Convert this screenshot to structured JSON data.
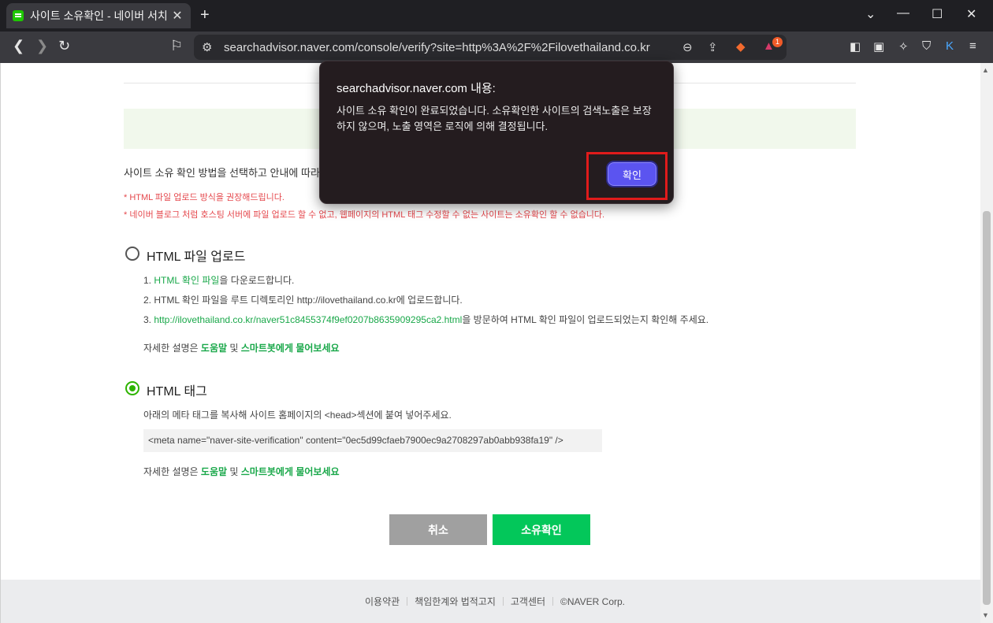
{
  "browser": {
    "tab_title": "사이트 소유확인 - 네이버 서치",
    "url": "searchadvisor.naver.com/console/verify?site=http%3A%2F%2Filovethailand.co.kr",
    "notification_count": "1"
  },
  "page": {
    "intro": "사이트 소유 확인 방법을 선택하고 안내에 따라 적용",
    "warnings": [
      "* HTML 파일 업로드 방식을 권장해드립니다.",
      "* 네이버 블로그 처럼 호스팅 서버에 파일 업로드 할 수 없고, 웹페이지의 HTML 태그 수정할 수 없는 사이트는 소유확인 할 수 없습니다."
    ],
    "html_file": {
      "title": "HTML 파일 업로드",
      "step1_prefix": "1. ",
      "step1_link": "HTML 확인 파일",
      "step1_suffix": "을 다운로드합니다.",
      "step2": "2. HTML 확인 파일을 루트 디렉토리인 http://ilovethailand.co.kr에 업로드합니다.",
      "step3_prefix": "3. ",
      "step3_link": "http://ilovethailand.co.kr/naver51c8455374f9ef0207b8635909295ca2.html",
      "step3_suffix": "을 방문하여 HTML 확인 파일이 업로드되었는지 확인해 주세요.",
      "help_prefix": "자세한 설명은 ",
      "help_link1": "도움말",
      "help_mid": " 및 ",
      "help_link2": "스마트봇에게 물어보세요"
    },
    "html_tag": {
      "title": "HTML 태그",
      "desc": "아래의 메타 태그를 복사해 사이트 홈페이지의 <head>섹션에 붙여 넣어주세요.",
      "meta_code": "<meta name=\"naver-site-verification\" content=\"0ec5d99cfaeb7900ec9a2708297ab0abb938fa19\" />",
      "help_prefix": "자세한 설명은 ",
      "help_link1": "도움말",
      "help_mid": " 및 ",
      "help_link2": "스마트봇에게 물어보세요"
    },
    "buttons": {
      "cancel": "취소",
      "verify": "소유확인"
    },
    "footer": [
      "이용약관",
      "책임한계와 법적고지",
      "고객센터",
      "©NAVER Corp."
    ]
  },
  "dialog": {
    "title": "searchadvisor.naver.com 내용:",
    "message": "사이트 소유 확인이 완료되었습니다. 소유확인한 사이트의 검색노출은 보장하지 않으며, 노출 영역은 로직에 의해 결정됩니다.",
    "ok_label": "확인"
  },
  "colors": {
    "accent_green": "#03c75a",
    "link_green": "#1aa84a",
    "warning_red": "#e5484d",
    "dialog_button": "#5b54f0",
    "highlight_red": "#e01b1b"
  }
}
